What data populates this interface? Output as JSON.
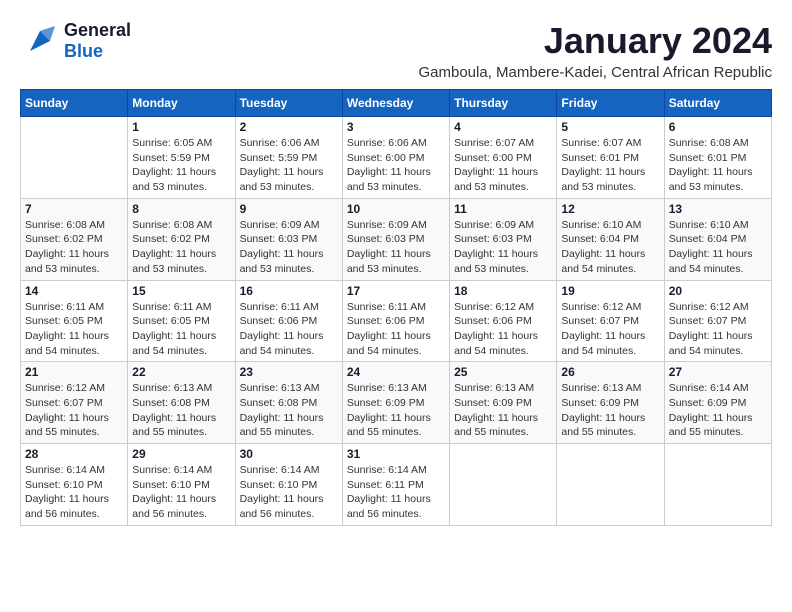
{
  "header": {
    "logo_line1": "General",
    "logo_line2": "Blue",
    "title": "January 2024",
    "subtitle": "Gamboula, Mambere-Kadei, Central African Republic"
  },
  "days_of_week": [
    "Sunday",
    "Monday",
    "Tuesday",
    "Wednesday",
    "Thursday",
    "Friday",
    "Saturday"
  ],
  "weeks": [
    [
      {
        "day": "",
        "sunrise": "",
        "sunset": "",
        "daylight": ""
      },
      {
        "day": "1",
        "sunrise": "Sunrise: 6:05 AM",
        "sunset": "Sunset: 5:59 PM",
        "daylight": "Daylight: 11 hours and 53 minutes."
      },
      {
        "day": "2",
        "sunrise": "Sunrise: 6:06 AM",
        "sunset": "Sunset: 5:59 PM",
        "daylight": "Daylight: 11 hours and 53 minutes."
      },
      {
        "day": "3",
        "sunrise": "Sunrise: 6:06 AM",
        "sunset": "Sunset: 6:00 PM",
        "daylight": "Daylight: 11 hours and 53 minutes."
      },
      {
        "day": "4",
        "sunrise": "Sunrise: 6:07 AM",
        "sunset": "Sunset: 6:00 PM",
        "daylight": "Daylight: 11 hours and 53 minutes."
      },
      {
        "day": "5",
        "sunrise": "Sunrise: 6:07 AM",
        "sunset": "Sunset: 6:01 PM",
        "daylight": "Daylight: 11 hours and 53 minutes."
      },
      {
        "day": "6",
        "sunrise": "Sunrise: 6:08 AM",
        "sunset": "Sunset: 6:01 PM",
        "daylight": "Daylight: 11 hours and 53 minutes."
      }
    ],
    [
      {
        "day": "7",
        "sunrise": "Sunrise: 6:08 AM",
        "sunset": "Sunset: 6:02 PM",
        "daylight": "Daylight: 11 hours and 53 minutes."
      },
      {
        "day": "8",
        "sunrise": "Sunrise: 6:08 AM",
        "sunset": "Sunset: 6:02 PM",
        "daylight": "Daylight: 11 hours and 53 minutes."
      },
      {
        "day": "9",
        "sunrise": "Sunrise: 6:09 AM",
        "sunset": "Sunset: 6:03 PM",
        "daylight": "Daylight: 11 hours and 53 minutes."
      },
      {
        "day": "10",
        "sunrise": "Sunrise: 6:09 AM",
        "sunset": "Sunset: 6:03 PM",
        "daylight": "Daylight: 11 hours and 53 minutes."
      },
      {
        "day": "11",
        "sunrise": "Sunrise: 6:09 AM",
        "sunset": "Sunset: 6:03 PM",
        "daylight": "Daylight: 11 hours and 53 minutes."
      },
      {
        "day": "12",
        "sunrise": "Sunrise: 6:10 AM",
        "sunset": "Sunset: 6:04 PM",
        "daylight": "Daylight: 11 hours and 54 minutes."
      },
      {
        "day": "13",
        "sunrise": "Sunrise: 6:10 AM",
        "sunset": "Sunset: 6:04 PM",
        "daylight": "Daylight: 11 hours and 54 minutes."
      }
    ],
    [
      {
        "day": "14",
        "sunrise": "Sunrise: 6:11 AM",
        "sunset": "Sunset: 6:05 PM",
        "daylight": "Daylight: 11 hours and 54 minutes."
      },
      {
        "day": "15",
        "sunrise": "Sunrise: 6:11 AM",
        "sunset": "Sunset: 6:05 PM",
        "daylight": "Daylight: 11 hours and 54 minutes."
      },
      {
        "day": "16",
        "sunrise": "Sunrise: 6:11 AM",
        "sunset": "Sunset: 6:06 PM",
        "daylight": "Daylight: 11 hours and 54 minutes."
      },
      {
        "day": "17",
        "sunrise": "Sunrise: 6:11 AM",
        "sunset": "Sunset: 6:06 PM",
        "daylight": "Daylight: 11 hours and 54 minutes."
      },
      {
        "day": "18",
        "sunrise": "Sunrise: 6:12 AM",
        "sunset": "Sunset: 6:06 PM",
        "daylight": "Daylight: 11 hours and 54 minutes."
      },
      {
        "day": "19",
        "sunrise": "Sunrise: 6:12 AM",
        "sunset": "Sunset: 6:07 PM",
        "daylight": "Daylight: 11 hours and 54 minutes."
      },
      {
        "day": "20",
        "sunrise": "Sunrise: 6:12 AM",
        "sunset": "Sunset: 6:07 PM",
        "daylight": "Daylight: 11 hours and 54 minutes."
      }
    ],
    [
      {
        "day": "21",
        "sunrise": "Sunrise: 6:12 AM",
        "sunset": "Sunset: 6:07 PM",
        "daylight": "Daylight: 11 hours and 55 minutes."
      },
      {
        "day": "22",
        "sunrise": "Sunrise: 6:13 AM",
        "sunset": "Sunset: 6:08 PM",
        "daylight": "Daylight: 11 hours and 55 minutes."
      },
      {
        "day": "23",
        "sunrise": "Sunrise: 6:13 AM",
        "sunset": "Sunset: 6:08 PM",
        "daylight": "Daylight: 11 hours and 55 minutes."
      },
      {
        "day": "24",
        "sunrise": "Sunrise: 6:13 AM",
        "sunset": "Sunset: 6:09 PM",
        "daylight": "Daylight: 11 hours and 55 minutes."
      },
      {
        "day": "25",
        "sunrise": "Sunrise: 6:13 AM",
        "sunset": "Sunset: 6:09 PM",
        "daylight": "Daylight: 11 hours and 55 minutes."
      },
      {
        "day": "26",
        "sunrise": "Sunrise: 6:13 AM",
        "sunset": "Sunset: 6:09 PM",
        "daylight": "Daylight: 11 hours and 55 minutes."
      },
      {
        "day": "27",
        "sunrise": "Sunrise: 6:14 AM",
        "sunset": "Sunset: 6:09 PM",
        "daylight": "Daylight: 11 hours and 55 minutes."
      }
    ],
    [
      {
        "day": "28",
        "sunrise": "Sunrise: 6:14 AM",
        "sunset": "Sunset: 6:10 PM",
        "daylight": "Daylight: 11 hours and 56 minutes."
      },
      {
        "day": "29",
        "sunrise": "Sunrise: 6:14 AM",
        "sunset": "Sunset: 6:10 PM",
        "daylight": "Daylight: 11 hours and 56 minutes."
      },
      {
        "day": "30",
        "sunrise": "Sunrise: 6:14 AM",
        "sunset": "Sunset: 6:10 PM",
        "daylight": "Daylight: 11 hours and 56 minutes."
      },
      {
        "day": "31",
        "sunrise": "Sunrise: 6:14 AM",
        "sunset": "Sunset: 6:11 PM",
        "daylight": "Daylight: 11 hours and 56 minutes."
      },
      {
        "day": "",
        "sunrise": "",
        "sunset": "",
        "daylight": ""
      },
      {
        "day": "",
        "sunrise": "",
        "sunset": "",
        "daylight": ""
      },
      {
        "day": "",
        "sunrise": "",
        "sunset": "",
        "daylight": ""
      }
    ]
  ]
}
